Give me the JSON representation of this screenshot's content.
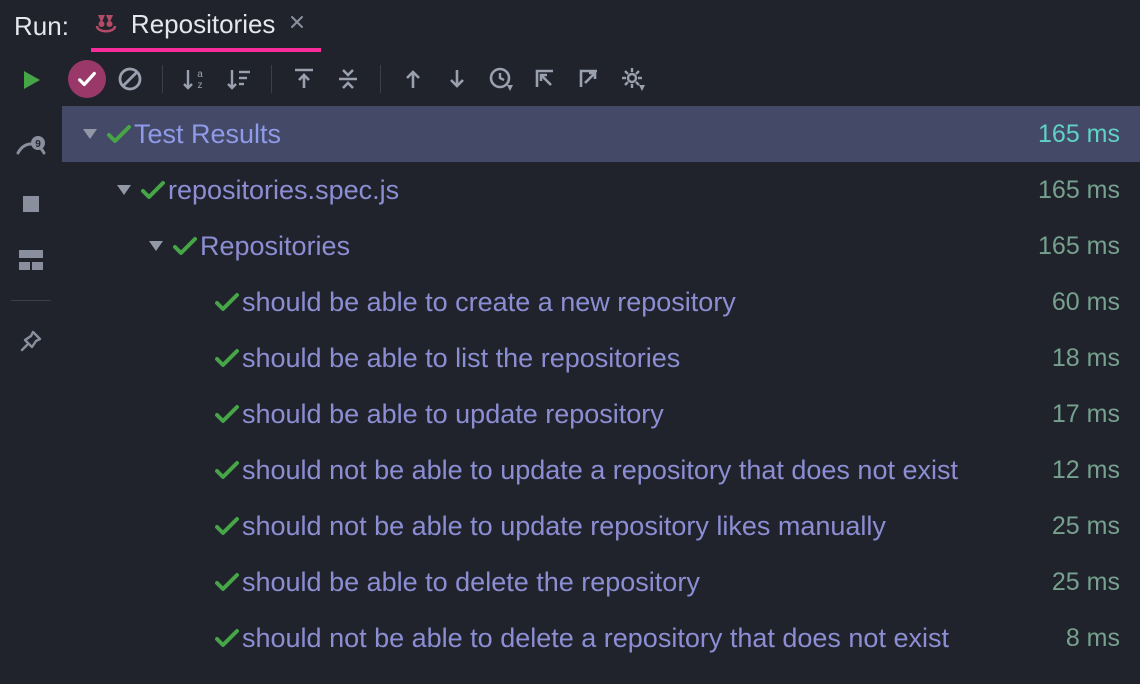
{
  "run_label": "Run:",
  "tab": {
    "title": "Repositories"
  },
  "root": {
    "label": "Test Results",
    "time": "165 ms"
  },
  "file": {
    "label": "repositories.spec.js",
    "time": "165 ms"
  },
  "suite": {
    "label": "Repositories",
    "time": "165 ms"
  },
  "tests": [
    {
      "label": "should be able to create a new repository",
      "time": "60 ms"
    },
    {
      "label": "should be able to list the repositories",
      "time": "18 ms"
    },
    {
      "label": "should be able to update repository",
      "time": "17 ms"
    },
    {
      "label": "should not be able to update a repository that does not exist",
      "time": "12 ms"
    },
    {
      "label": "should not be able to update repository likes manually",
      "time": "25 ms"
    },
    {
      "label": "should be able to delete the repository",
      "time": "25 ms"
    },
    {
      "label": "should not be able to delete a repository that does not exist",
      "time": "8 ms"
    }
  ]
}
